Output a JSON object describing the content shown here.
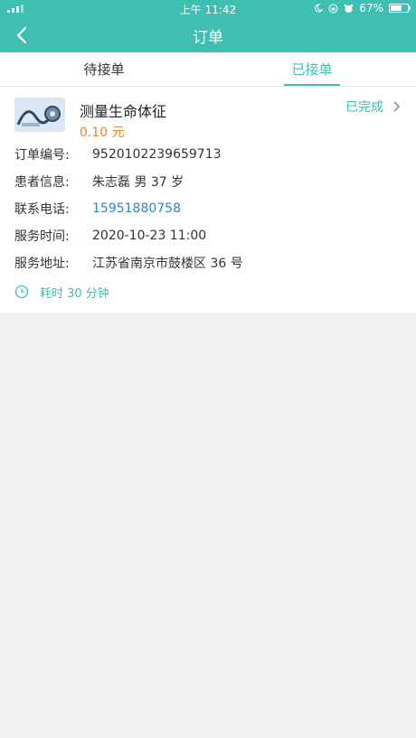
{
  "status_bar": {
    "time": "上午 11:42",
    "battery_percent": "67%",
    "battery_level": 0.67
  },
  "navbar": {
    "title": "订单",
    "back_icon": "chevron-left-icon"
  },
  "tabs": [
    {
      "label": "待接单",
      "active": false
    },
    {
      "label": "已接单",
      "active": true
    }
  ],
  "order": {
    "service_name": "测量生命体征",
    "price": "0.10 元",
    "status": "已完成",
    "fields": [
      {
        "label": "订单编号:",
        "value": "9520102239659713"
      },
      {
        "label": "患者信息:",
        "value": "朱志磊 男 37 岁"
      },
      {
        "label": "联系电话:",
        "value": "15951880758"
      },
      {
        "label": "服务时间:",
        "value": "2020-10-23 11:00"
      },
      {
        "label": "服务地址:",
        "value": "江苏省南京市鼓楼区 36 号"
      }
    ],
    "duration": "耗时 30 分钟"
  },
  "colors": {
    "accent": "#3ebfb2",
    "price": "#e8872f",
    "phone": "#2f86c7"
  }
}
